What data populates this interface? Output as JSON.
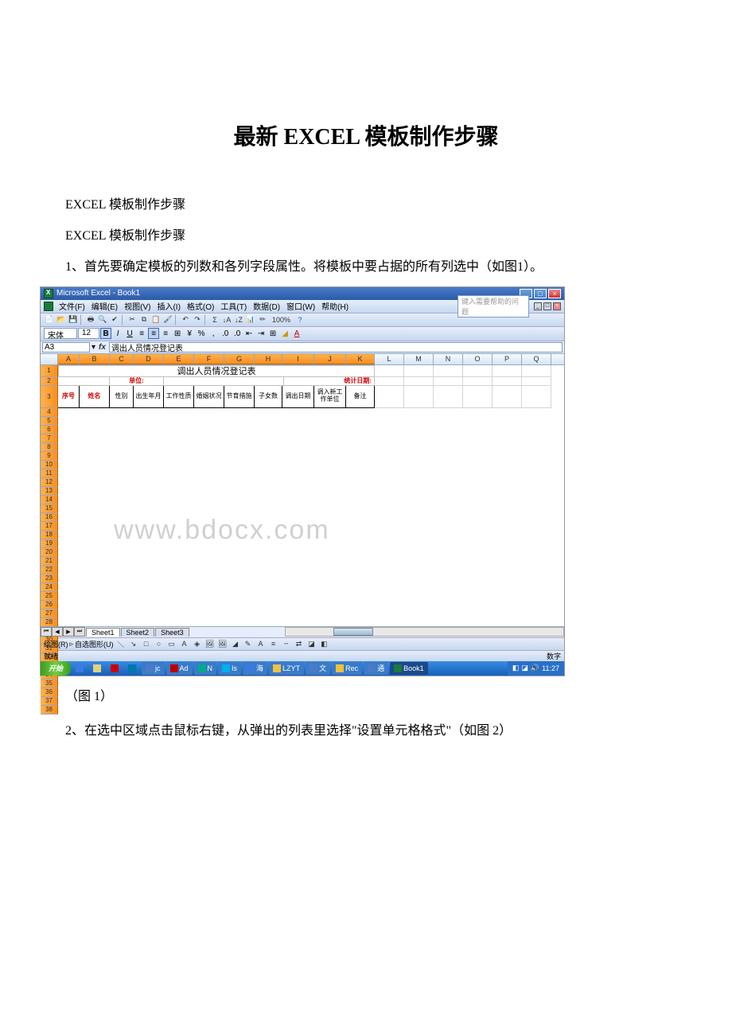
{
  "doc": {
    "title": "最新 EXCEL 模板制作步骤",
    "p1": "EXCEL 模板制作步骤",
    "p2": "EXCEL 模板制作步骤",
    "p3": "1、首先要确定模板的列数和各列字段属性。将模板中要占据的所有列选中（如图1）。",
    "caption1": "（图 1）",
    "p4": "2、在选中区域点击鼠标右键，从弹出的列表里选择\"设置单元格格式\"（如图 2）"
  },
  "excel": {
    "title": "Microsoft Excel - Book1",
    "menu": {
      "file": "文件(F)",
      "edit": "编辑(E)",
      "view": "视图(V)",
      "insert": "插入(I)",
      "format": "格式(O)",
      "tools": "工具(T)",
      "data": "数据(D)",
      "window": "窗口(W)",
      "help": "帮助(H)",
      "helpbox": "键入需要帮助的问题"
    },
    "font": {
      "name": "宋体",
      "size": "12"
    },
    "namebox": "A3",
    "formula": "调出人员情况登记表",
    "sheet_title": "调出人员情况登记表",
    "unit_label": "单位:",
    "stat_date_label": "统计日期:",
    "headers": [
      "序号",
      "姓名",
      "性别",
      "出生年月",
      "工作性质",
      "婚姻状况",
      "节育措施",
      "子女数",
      "调出日期",
      "调入新工作单位",
      "备注"
    ],
    "cols": [
      "A",
      "B",
      "C",
      "D",
      "E",
      "F",
      "G",
      "H",
      "I",
      "J",
      "K",
      "L",
      "M",
      "N",
      "O",
      "P",
      "Q"
    ],
    "sheets": [
      "Sheet1",
      "Sheet2",
      "Sheet3"
    ],
    "draw_label": "绘图(R)",
    "autoshape": "自选图形(U)",
    "status": "就绪",
    "numlock": "数字",
    "watermark": "www.bdocx.com",
    "zoom": "100%"
  },
  "taskbar": {
    "start": "开始",
    "items": [
      "jc",
      "Ad",
      "N",
      "Is",
      "海",
      "LZYT",
      "文",
      "Rec",
      "通",
      "Book1"
    ],
    "time": "11:27"
  },
  "chart_data": {
    "type": "table",
    "title": "调出人员情况登记表",
    "columns": [
      "序号",
      "姓名",
      "性别",
      "出生年月",
      "工作性质",
      "婚姻状况",
      "节育措施",
      "子女数",
      "调出日期",
      "调入新工作单位",
      "备注"
    ],
    "rows": []
  }
}
